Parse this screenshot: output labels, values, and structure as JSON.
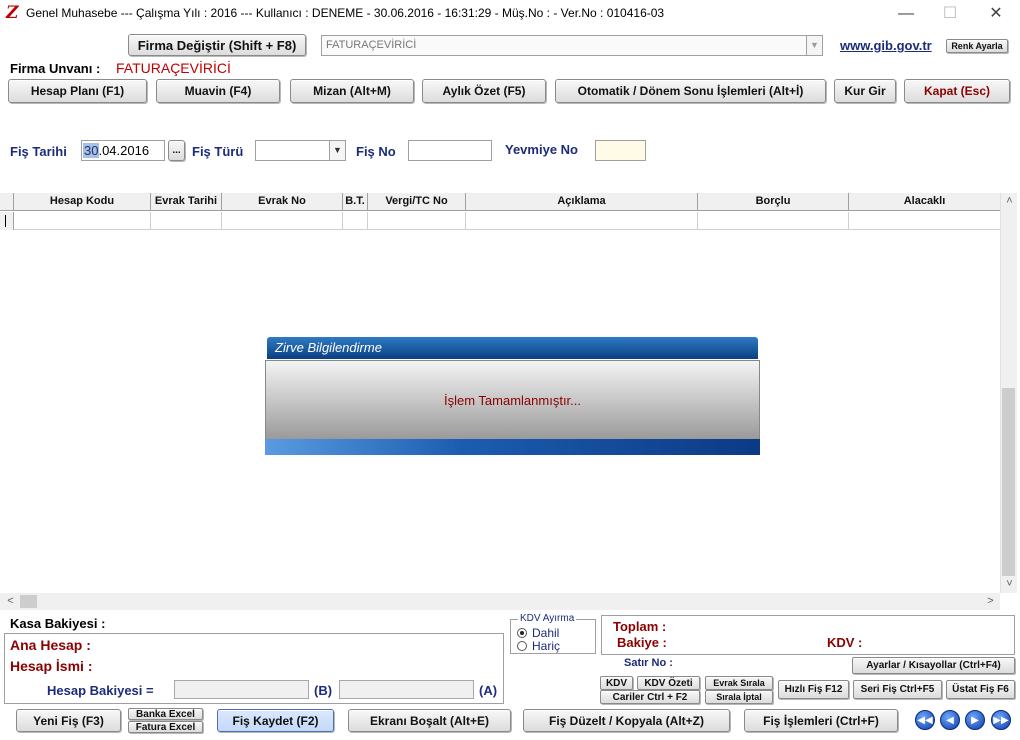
{
  "window": {
    "title": "Genel Muhasebe  ---  Çalışma Yılı : 2016  ---  Kullanıcı : DENEME - 30.06.2016 - 16:31:29 - Müş.No : - Ver.No : 010416-03",
    "logo": "Z"
  },
  "header": {
    "firma_degistir": "Firma Değiştir (Shift + F8)",
    "firma_combo": "FATURAÇEVİRİCİ",
    "gib_link": "www.gib.gov.tr",
    "renk_ayarla": "Renk Ayarla",
    "firma_unvani_label": "Firma Unvanı :",
    "firma_unvani_value": "FATURAÇEVİRİCİ"
  },
  "toolbar": {
    "hesap_plani": "Hesap Planı (F1)",
    "muavin": "Muavin (F4)",
    "mizan": "Mizan (Alt+M)",
    "aylik_ozet": "Aylık Özet (F5)",
    "otomatik": "Otomatik / Dönem Sonu İşlemleri (Alt+İ)",
    "kur_gir": "Kur Gir",
    "kapat": "Kapat (Esc)"
  },
  "fis": {
    "tarihi_label": "Fiş Tarihi",
    "tarihi_value": "30.04.2016",
    "picker": "...",
    "turu_label": "Fiş Türü",
    "no_label": "Fiş No",
    "yevmiye_label": "Yevmiye No"
  },
  "grid": {
    "columns": [
      "Hesap Kodu",
      "Evrak Tarihi",
      "Evrak No",
      "B.T.",
      "Vergi/TC No",
      "Açıklama",
      "Borçlu",
      "Alacaklı"
    ]
  },
  "dialog": {
    "title": "Zirve Bilgilendirme",
    "message": "İşlem Tamamlanmıştır..."
  },
  "bottom": {
    "kasa_bakiyesi": "Kasa Bakiyesi :",
    "ana_hesap": "Ana Hesap :",
    "hesap_ismi": "Hesap İsmi :",
    "hesap_bakiyesi": "Hesap Bakiyesi =",
    "b_marker": "(B)",
    "a_marker": "(A)",
    "kdv_ayirma": "KDV Ayırma",
    "dahil": "Dahil",
    "haric": "Hariç",
    "toplam": "Toplam :",
    "bakiye": "Bakiye :",
    "kdv_label": "KDV :",
    "satir_no": "Satır No :",
    "ayarlar": "Ayarlar / Kısayollar (Ctrl+F4)",
    "kdv_btn": "KDV",
    "kdv_ozeti": "KDV Özeti",
    "evrak_sirala": "Evrak Sırala",
    "cariler": "Cariler Ctrl + F2",
    "sirala_iptal": "Sırala İptal",
    "hizli_fis": "Hızlı Fiş F12",
    "seri_fis": "Seri Fiş Ctrl+F5",
    "ustat_fis": "Üstat Fiş F6"
  },
  "footer": {
    "yeni_fis": "Yeni Fiş (F3)",
    "banka_excel": "Banka Excel",
    "fatura_excel": "Fatura Excel",
    "fis_kaydet": "Fiş Kaydet (F2)",
    "ekrani_bosalt": "Ekranı Boşalt (Alt+E)",
    "fis_duzelt": "Fiş Düzelt / Kopyala (Alt+Z)",
    "fis_islemleri": "Fiş İşlemleri (Ctrl+F)"
  },
  "colors": {
    "accent_red": "#8b0000",
    "label_blue": "#1c2c7a",
    "dialog_blue": "#0a3f80"
  }
}
